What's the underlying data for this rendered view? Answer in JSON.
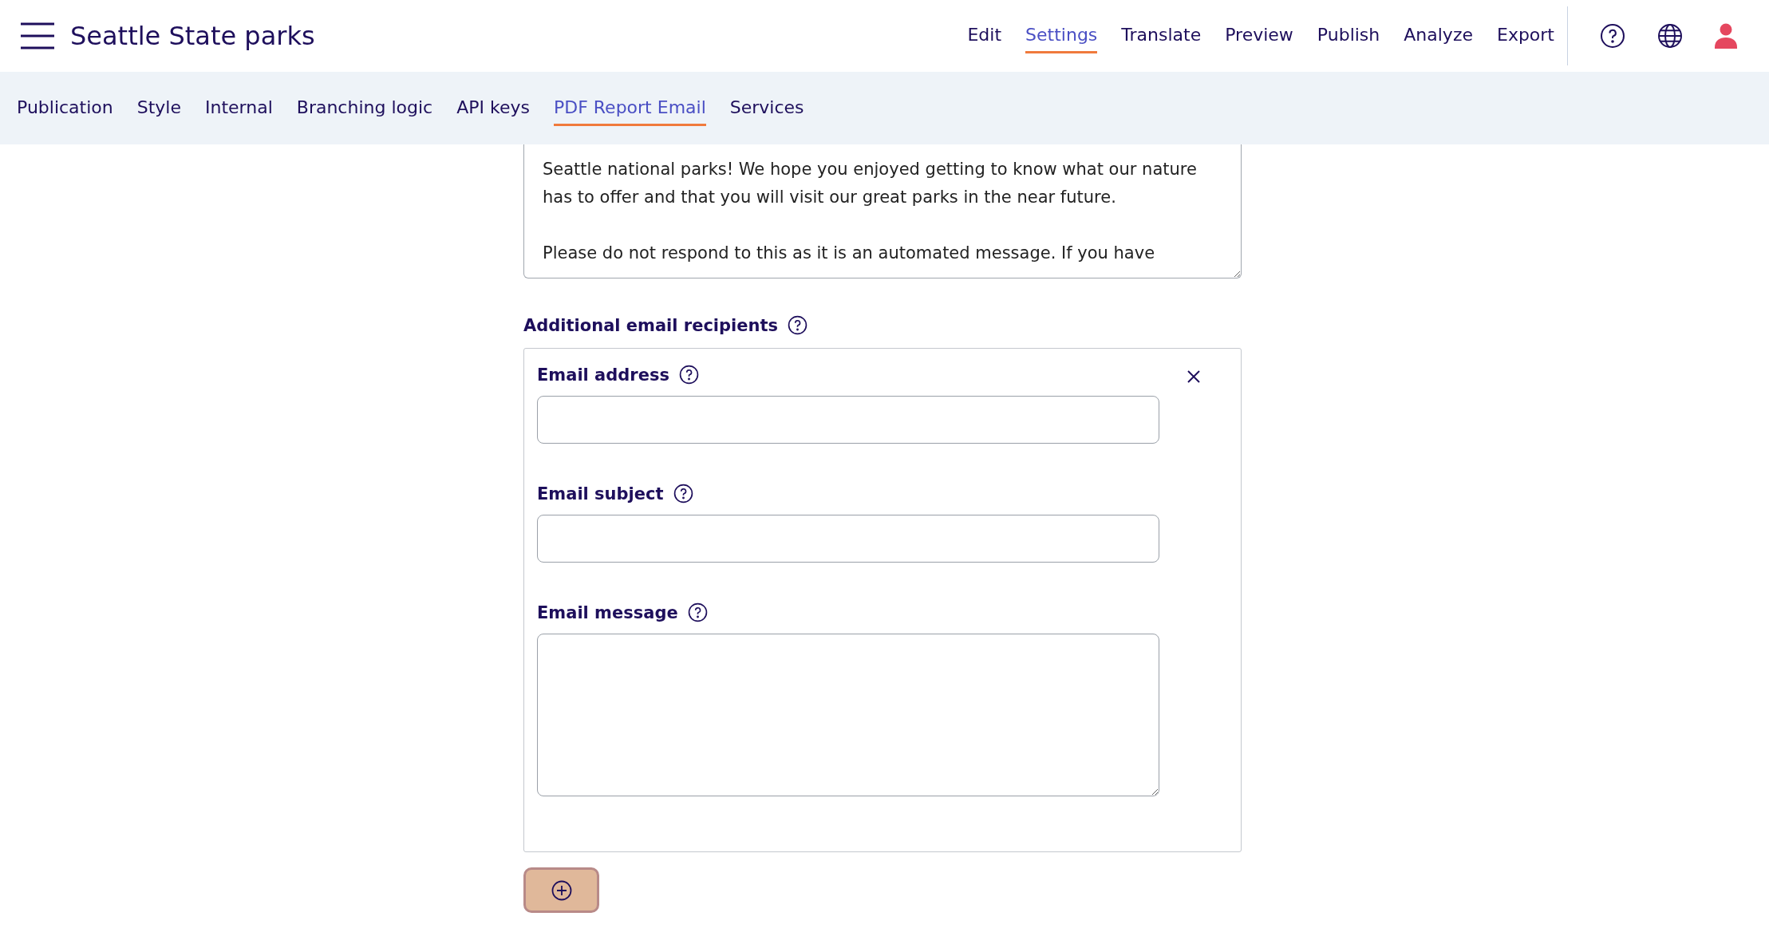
{
  "header": {
    "title": "Seattle State parks",
    "nav": [
      {
        "label": "Edit",
        "selected": false
      },
      {
        "label": "Settings",
        "selected": true
      },
      {
        "label": "Translate",
        "selected": false
      },
      {
        "label": "Preview",
        "selected": false
      },
      {
        "label": "Publish",
        "selected": false
      },
      {
        "label": "Analyze",
        "selected": false
      },
      {
        "label": "Export",
        "selected": false
      }
    ]
  },
  "subnav": [
    {
      "label": "Publication",
      "selected": false
    },
    {
      "label": "Style",
      "selected": false
    },
    {
      "label": "Internal",
      "selected": false
    },
    {
      "label": "Branching logic",
      "selected": false
    },
    {
      "label": "API keys",
      "selected": false
    },
    {
      "label": "PDF Report Email",
      "selected": true
    },
    {
      "label": "Services",
      "selected": false
    }
  ],
  "message": {
    "value": "Seattle national parks! We hope you enjoyed getting to know what our nature\nhas to offer and that you will visit our great parks in the near future.\n\nPlease do not respond to this as it is an automated message. If you have"
  },
  "recipients": {
    "title": "Additional email recipients",
    "fields": [
      {
        "label": "Email address",
        "kind": "input"
      },
      {
        "label": "Email subject",
        "kind": "input"
      },
      {
        "label": "Email message",
        "kind": "textarea"
      }
    ]
  }
}
